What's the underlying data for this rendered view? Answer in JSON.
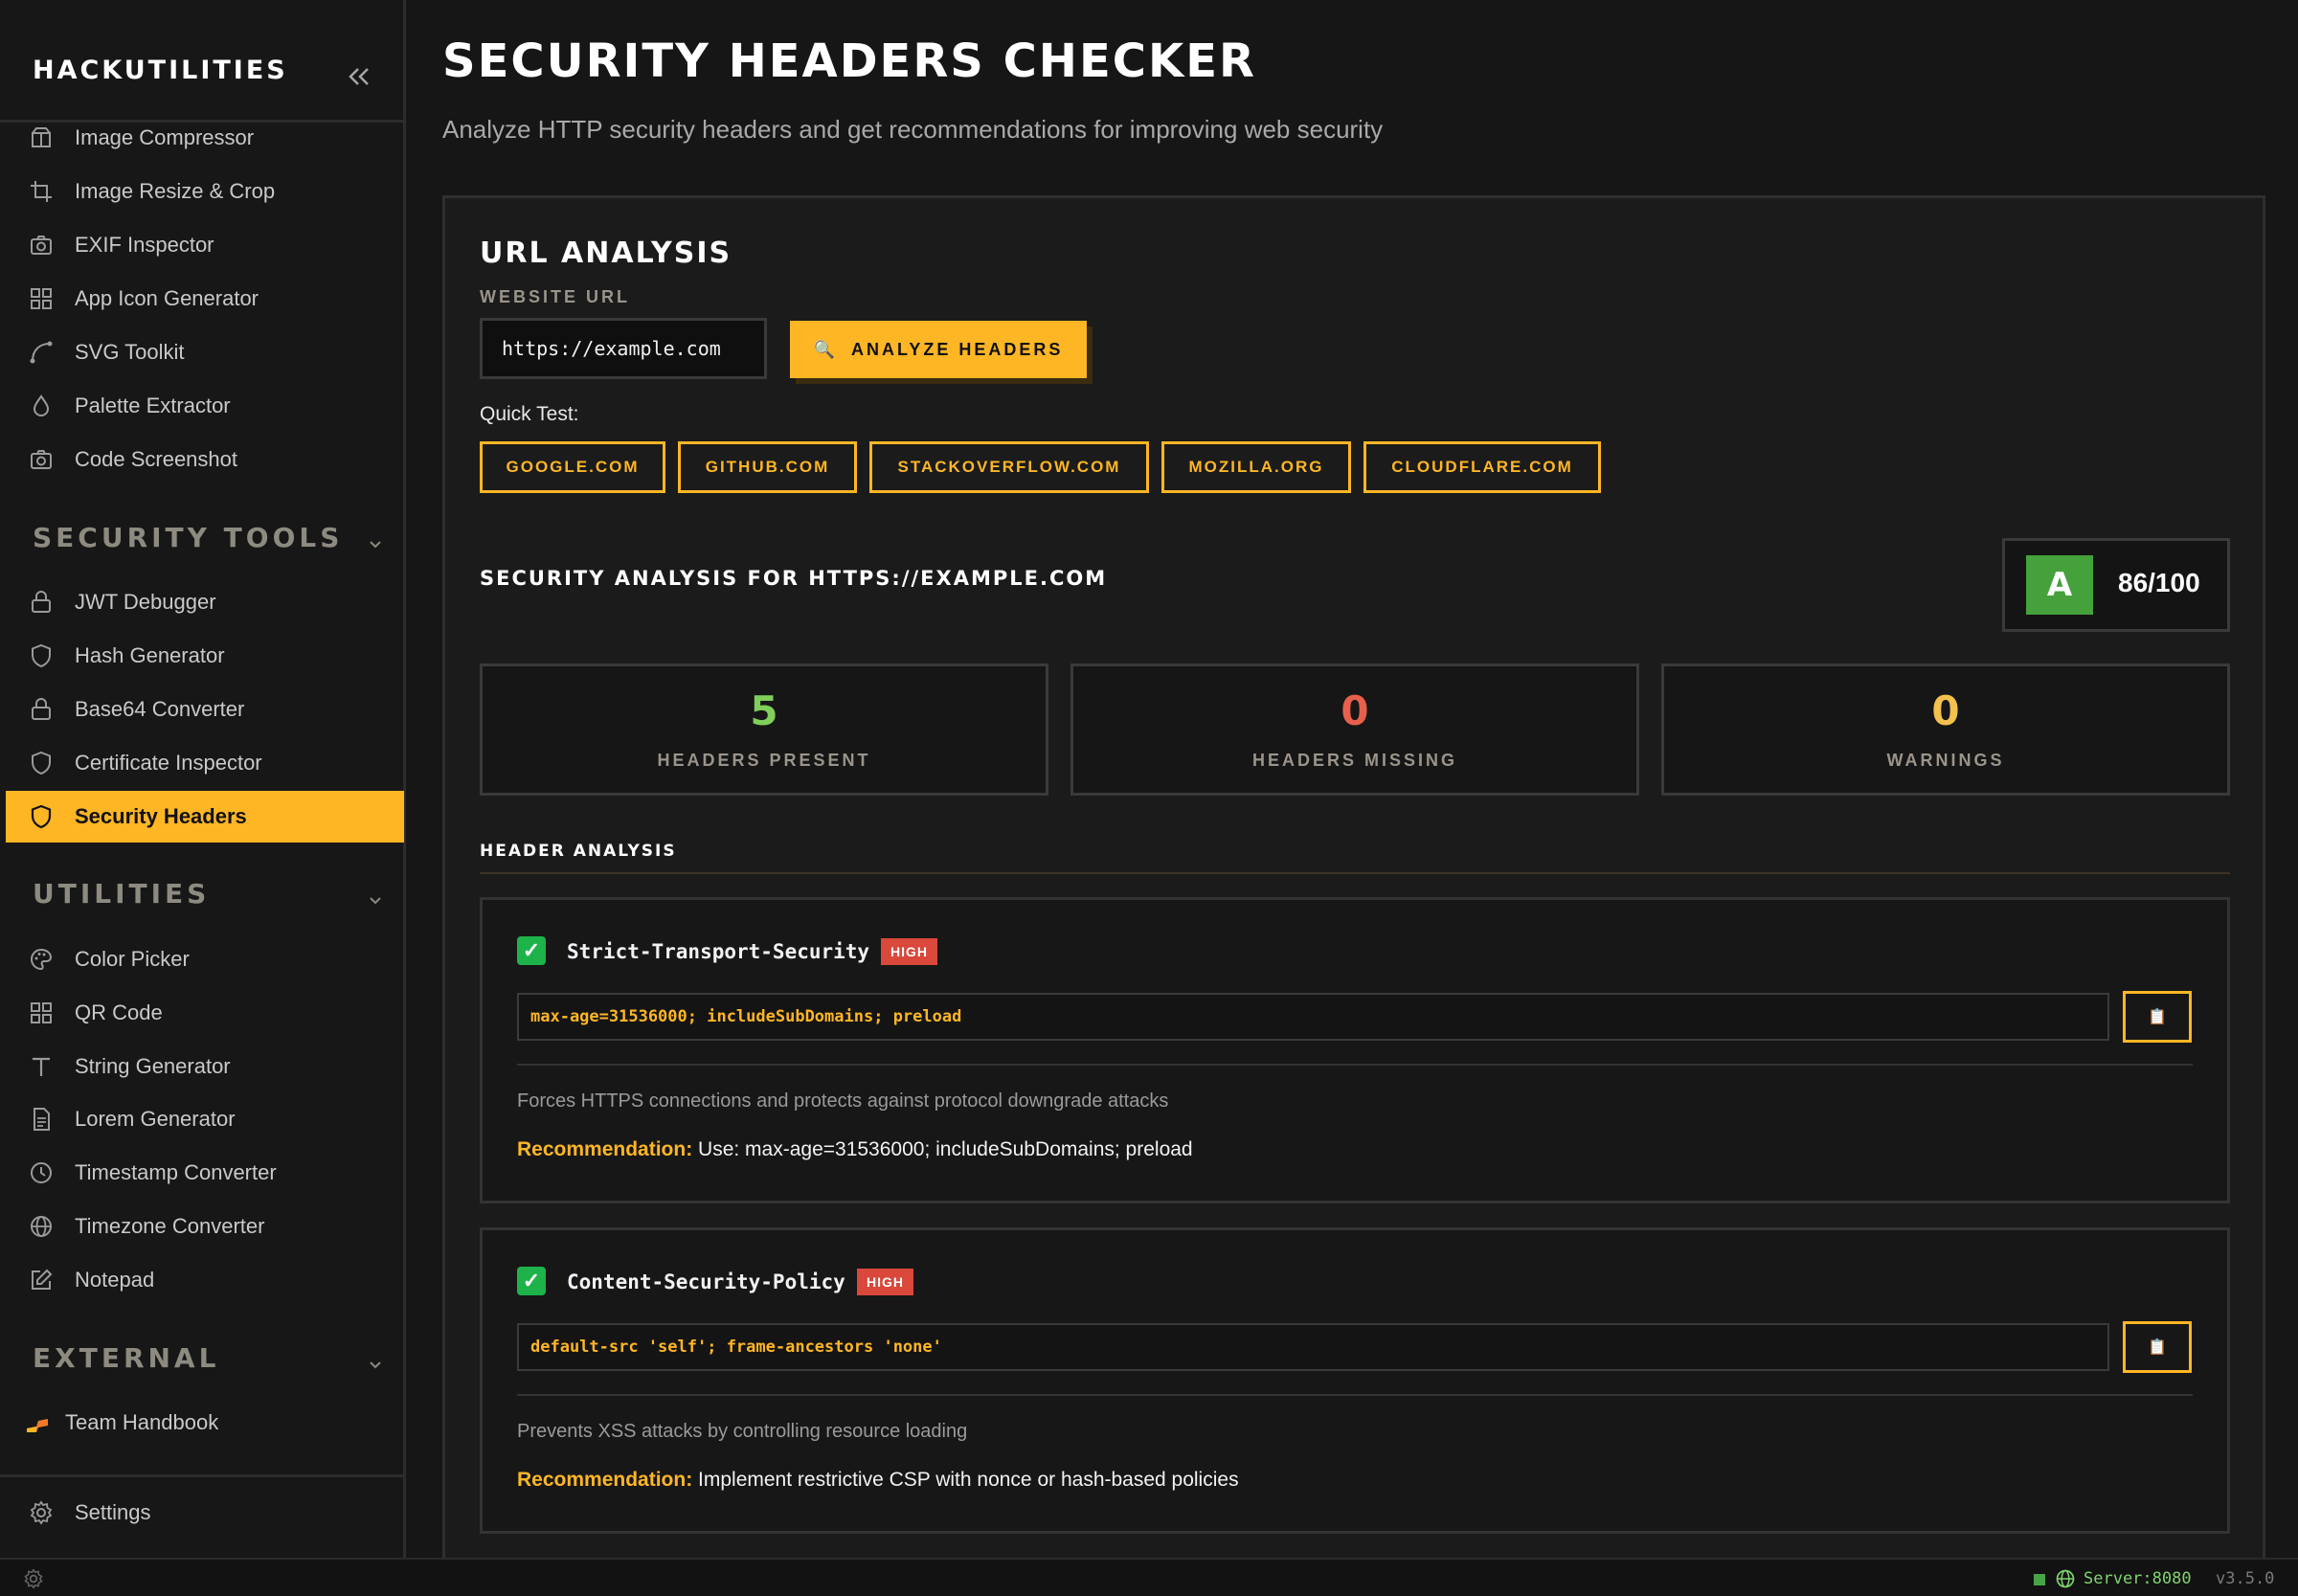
{
  "sidebar": {
    "brand": "HACKUTILITIES",
    "tools_items": [
      {
        "label": "Image Compressor",
        "icon": "package-icon"
      },
      {
        "label": "Image Resize & Crop",
        "icon": "crop-icon"
      },
      {
        "label": "EXIF Inspector",
        "icon": "camera-icon"
      },
      {
        "label": "App Icon Generator",
        "icon": "grid-icon"
      },
      {
        "label": "SVG Toolkit",
        "icon": "bezier-icon"
      },
      {
        "label": "Palette Extractor",
        "icon": "droplet-icon"
      },
      {
        "label": "Code Screenshot",
        "icon": "camera-icon"
      }
    ],
    "security_heading": "SECURITY TOOLS",
    "security_items": [
      {
        "label": "JWT Debugger",
        "icon": "lock-icon"
      },
      {
        "label": "Hash Generator",
        "icon": "shield-icon"
      },
      {
        "label": "Base64 Converter",
        "icon": "lock-icon"
      },
      {
        "label": "Certificate Inspector",
        "icon": "shield-icon"
      },
      {
        "label": "Security Headers",
        "icon": "shield-icon",
        "active": true
      }
    ],
    "utilities_heading": "UTILITIES",
    "utilities_items": [
      {
        "label": "Color Picker",
        "icon": "palette-icon"
      },
      {
        "label": "QR Code",
        "icon": "grid-icon"
      },
      {
        "label": "String Generator",
        "icon": "text-icon"
      },
      {
        "label": "Lorem Generator",
        "icon": "document-icon"
      },
      {
        "label": "Timestamp Converter",
        "icon": "clock-icon"
      },
      {
        "label": "Timezone Converter",
        "icon": "globe-icon"
      },
      {
        "label": "Notepad",
        "icon": "edit-icon"
      }
    ],
    "external_heading": "EXTERNAL",
    "external_items": [
      {
        "label": "Team Handbook",
        "icon": "handbook-icon"
      }
    ],
    "settings_label": "Settings"
  },
  "header": {
    "title": "SECURITY HEADERS CHECKER",
    "subtitle": "Analyze HTTP security headers and get recommendations for improving web security"
  },
  "url_analysis": {
    "heading": "URL ANALYSIS",
    "field_label": "WEBSITE URL",
    "url_value": "https://example.com",
    "analyze_label": "ANALYZE HEADERS",
    "analyze_icon": "🔍",
    "quick_test_label": "Quick Test:",
    "quick_tests": [
      "GOOGLE.COM",
      "GITHUB.COM",
      "STACKOVERFLOW.COM",
      "MOZILLA.ORG",
      "CLOUDFLARE.COM"
    ]
  },
  "results": {
    "title": "SECURITY ANALYSIS FOR HTTPS://EXAMPLE.COM",
    "grade": "A",
    "score": "86/100",
    "stats": [
      {
        "value": "5",
        "label": "HEADERS PRESENT",
        "color": "#7fcf5a"
      },
      {
        "value": "0",
        "label": "HEADERS MISSING",
        "color": "#e8604c"
      },
      {
        "value": "0",
        "label": "WARNINGS",
        "color": "#f2c14e"
      }
    ],
    "header_analysis_title": "HEADER ANALYSIS",
    "headers": [
      {
        "name": "Strict-Transport-Security",
        "severity": "HIGH",
        "value": "max-age=31536000; includeSubDomains; preload",
        "description": "Forces HTTPS connections and protects against protocol downgrade attacks",
        "recommendation_label": "Recommendation:",
        "recommendation": "Use: max-age=31536000; includeSubDomains; preload"
      },
      {
        "name": "Content-Security-Policy",
        "severity": "HIGH",
        "value": "default-src 'self'; frame-ancestors 'none'",
        "description": "Prevents XSS attacks by controlling resource loading",
        "recommendation_label": "Recommendation:",
        "recommendation": "Implement restrictive CSP with nonce or hash-based policies"
      }
    ],
    "copy_icon": "📋"
  },
  "statusbar": {
    "server": "Server:8080",
    "version": "v3.5.0"
  },
  "colors": {
    "accent": "#ffb625",
    "background": "#161616",
    "grade": "#45a13b",
    "severity_high": "#d9483b"
  }
}
